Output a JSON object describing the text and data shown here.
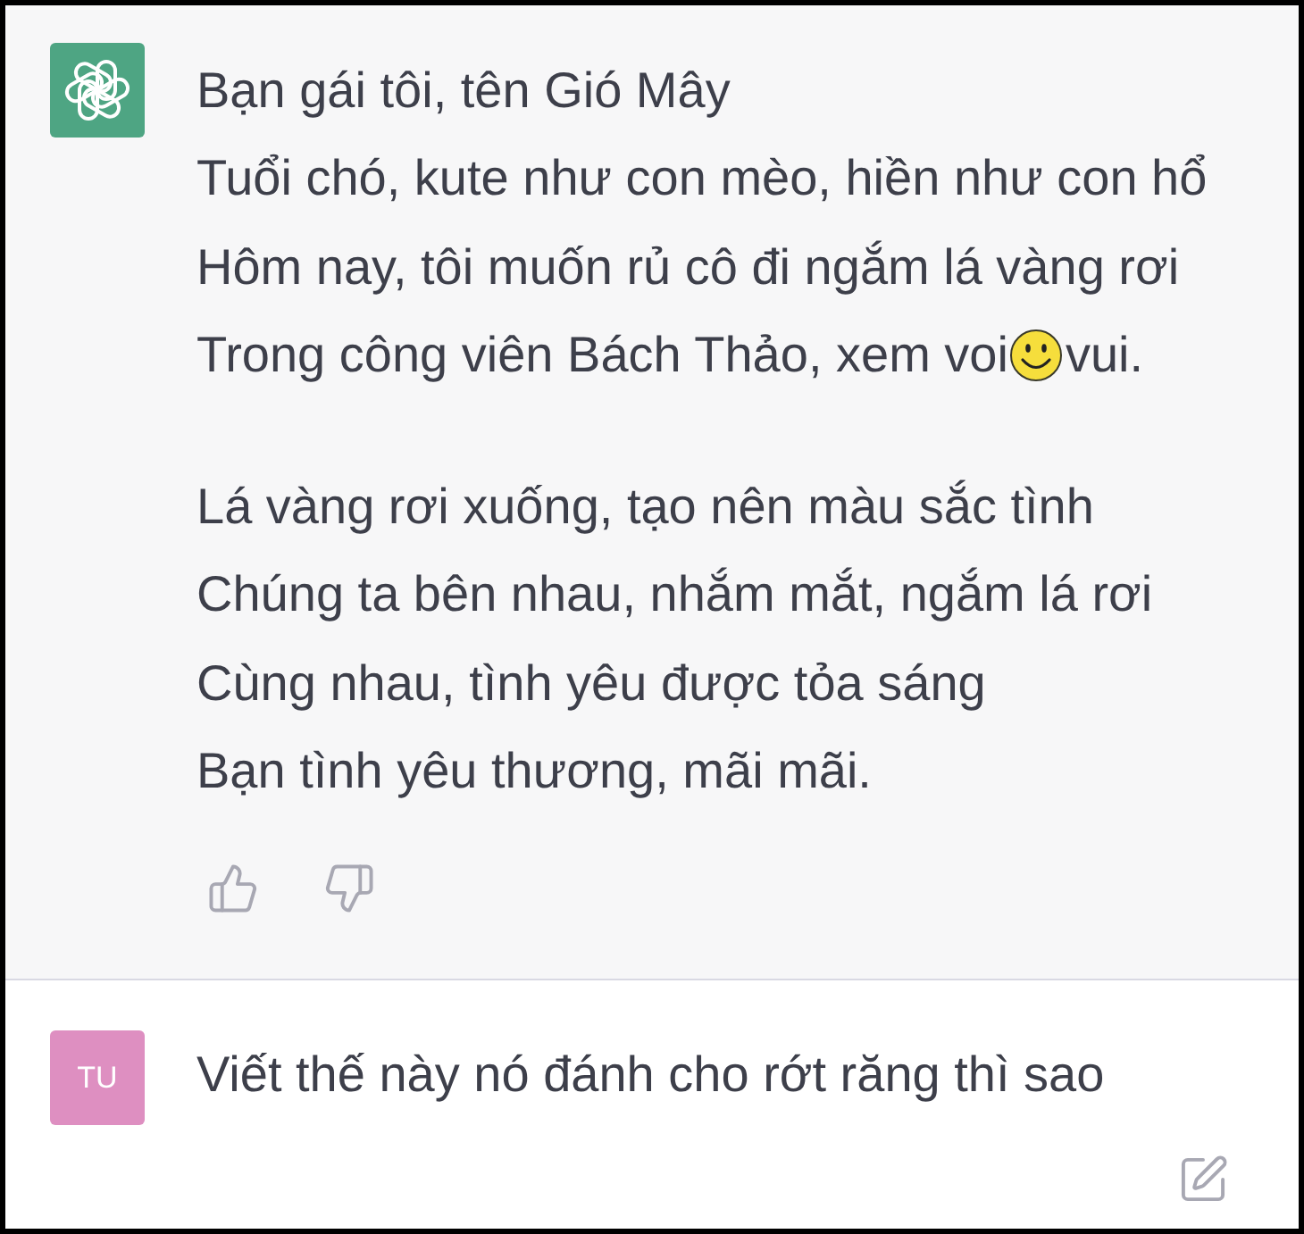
{
  "messages": [
    {
      "kind": "assistant",
      "paragraphs": [
        {
          "lines": [
            {
              "parts": [
                {
                  "kind": "text",
                  "text": "Bạn gái tôi, tên Gió Mây"
                }
              ]
            },
            {
              "parts": [
                {
                  "kind": "text",
                  "text": "Tuổi chó, kute như con mèo, hiền như con hổ"
                }
              ]
            },
            {
              "parts": [
                {
                  "kind": "text",
                  "text": "Hôm nay, tôi muốn rủ cô đi ngắm lá vàng rơi"
                }
              ]
            },
            {
              "parts": [
                {
                  "kind": "text",
                  "text": "Trong công viên Bách Thảo, xem voi"
                },
                {
                  "kind": "emoji"
                },
                {
                  "kind": "text",
                  "text": "vui."
                }
              ]
            }
          ]
        },
        {
          "lines": [
            {
              "parts": [
                {
                  "kind": "text",
                  "text": "Lá vàng rơi xuống, tạo nên màu sắc tình"
                }
              ]
            },
            {
              "parts": [
                {
                  "kind": "text",
                  "text": "Chúng ta bên nhau, nhắm mắt, ngắm lá rơi"
                }
              ]
            },
            {
              "parts": [
                {
                  "kind": "text",
                  "text": "Cùng nhau, tình yêu được tỏa sáng"
                }
              ]
            },
            {
              "parts": [
                {
                  "kind": "text",
                  "text": "Bạn tình yêu thương, mãi mãi."
                }
              ]
            }
          ]
        }
      ]
    },
    {
      "kind": "user",
      "avatar": {
        "initials": "TU"
      },
      "paragraphs": [
        {
          "lines": [
            {
              "parts": [
                {
                  "kind": "text",
                  "text": "Viết thế này nó đánh cho rớt răng thì sao"
                }
              ]
            }
          ]
        }
      ]
    }
  ]
}
